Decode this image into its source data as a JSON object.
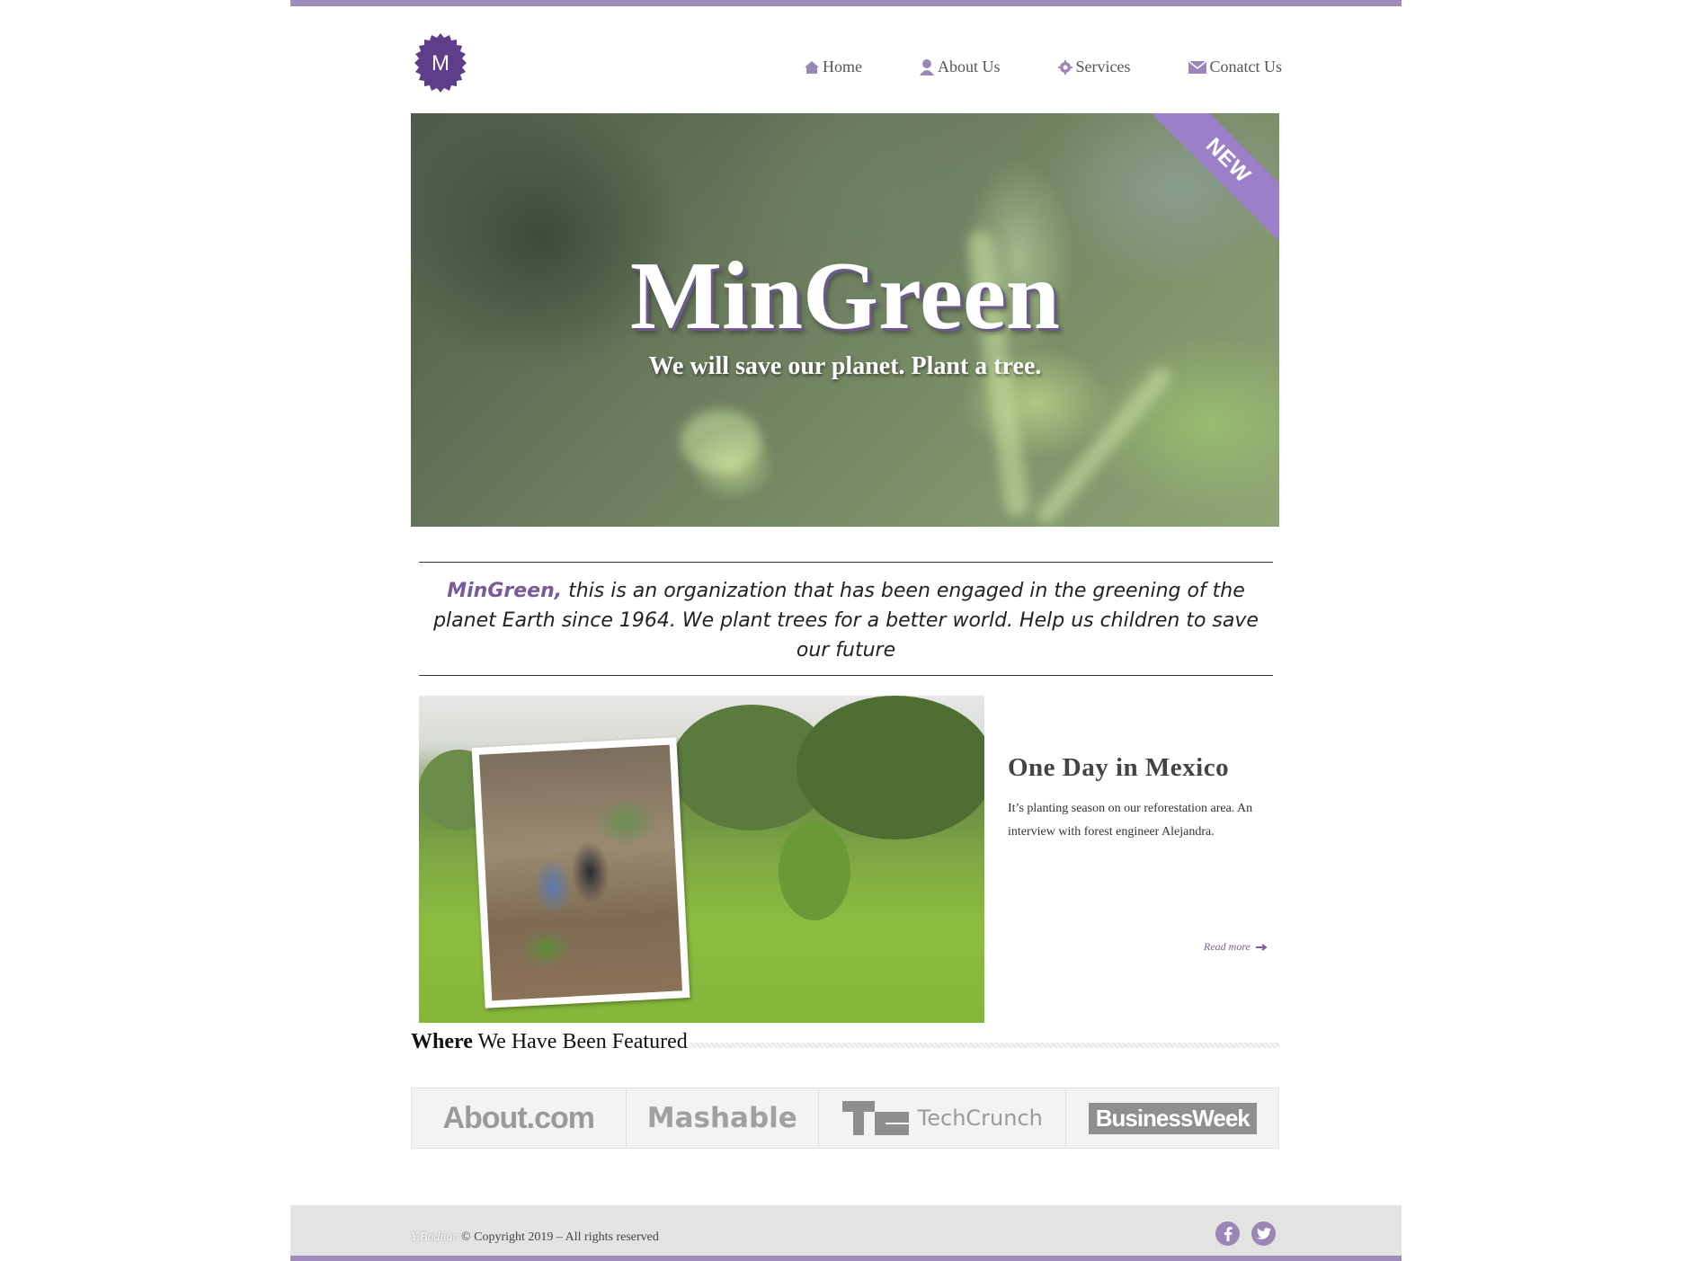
{
  "brand": {
    "logo_letter": "M",
    "accent": "#a08cbc",
    "purple": "#7a5a9a"
  },
  "nav": [
    {
      "label": "Home",
      "icon": "home-icon"
    },
    {
      "label": "About Us",
      "icon": "user-icon"
    },
    {
      "label": "Services",
      "icon": "gear-icon"
    },
    {
      "label": "Conatct Us",
      "icon": "envelope-icon"
    }
  ],
  "hero": {
    "title": "MinGreen",
    "subtitle": "We will save our planet. Plant a tree.",
    "ribbon": "NEW"
  },
  "intro": {
    "brand": "MinGreen,",
    "text": " this is an organization that has been engaged in the greening of the planet Earth since 1964. We plant trees for a better world. Help us children to save our future"
  },
  "article": {
    "title": "One Day in Mexico",
    "body": "It’s planting season on our reforestation area. An interview with forest engineer Alejandra.",
    "read_more": "Read more"
  },
  "featured": {
    "title_bold": "Where",
    "title_rest": " We Have Been Featured",
    "logos": [
      "About.com",
      "Mashable",
      "TechCrunch",
      "BusinessWeek"
    ]
  },
  "footer": {
    "signature": "Y.Bodnar",
    "copyright": "© Copyright 2019 – All rights reserved"
  }
}
